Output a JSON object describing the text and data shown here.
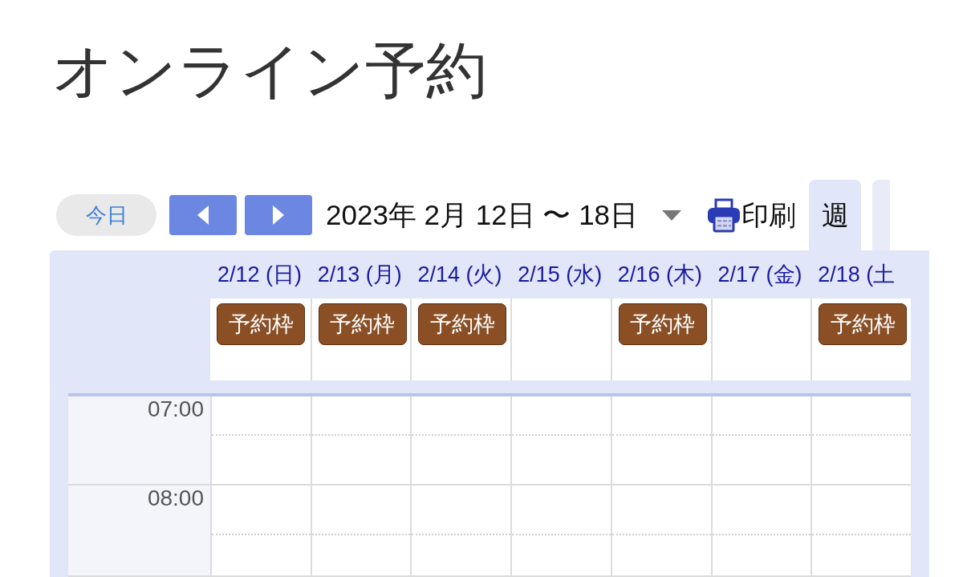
{
  "title": "オンライン予約",
  "toolbar": {
    "today_button": "今日",
    "date_range": "2023年 2月 12日 〜 18日",
    "print_button": "印刷"
  },
  "view_tabs": [
    {
      "label": "週",
      "selected": true
    },
    {
      "selected": false
    }
  ],
  "calendar": {
    "days": [
      {
        "label": "2/12 (日)",
        "slots": [
          "予約枠"
        ]
      },
      {
        "label": "2/13 (月)",
        "slots": [
          "予約枠"
        ]
      },
      {
        "label": "2/14 (火)",
        "slots": [
          "予約枠"
        ]
      },
      {
        "label": "2/15 (水)"
      },
      {
        "label": "2/16 (木)",
        "slots": [
          "予約枠"
        ]
      },
      {
        "label": "2/17 (金)"
      },
      {
        "label": "2/18 (土",
        "slots": [
          "予約枠"
        ]
      }
    ],
    "time_rows": [
      {
        "time": "07:00"
      },
      {
        "time": "08:00"
      }
    ]
  }
}
